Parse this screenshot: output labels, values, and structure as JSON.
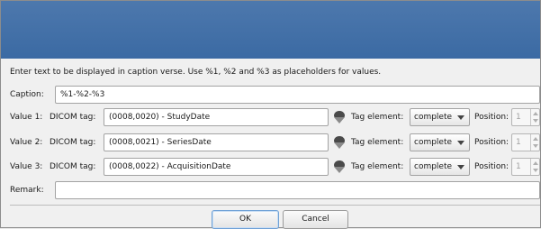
{
  "dialog": {
    "instructions": "Enter text to be displayed in caption verse. Use %1, %2 and %3 as placeholders for values.",
    "caption": {
      "label": "Caption:",
      "value": "%1-%2-%3"
    },
    "values": [
      {
        "label": "Value 1:",
        "tag_label": "DICOM tag:",
        "tag": "(0008,0020) - StudyDate",
        "element_label": "Tag element:",
        "element": "complete",
        "position_label": "Position:",
        "position": "1"
      },
      {
        "label": "Value 2:",
        "tag_label": "DICOM tag:",
        "tag": "(0008,0021) - SeriesDate",
        "element_label": "Tag element:",
        "element": "complete",
        "position_label": "Position:",
        "position": "1"
      },
      {
        "label": "Value 3:",
        "tag_label": "DICOM tag:",
        "tag": "(0008,0022) - AcquisitionDate",
        "element_label": "Tag element:",
        "element": "complete",
        "position_label": "Position:",
        "position": "1"
      }
    ],
    "remark": {
      "label": "Remark:",
      "value": ""
    },
    "ok_label": "OK",
    "cancel_label": "Cancel",
    "picker_icon": "tag-picker-icon",
    "colors": {
      "titlebar": "#4170a8",
      "default_button_border": "#6fa1d6"
    }
  }
}
